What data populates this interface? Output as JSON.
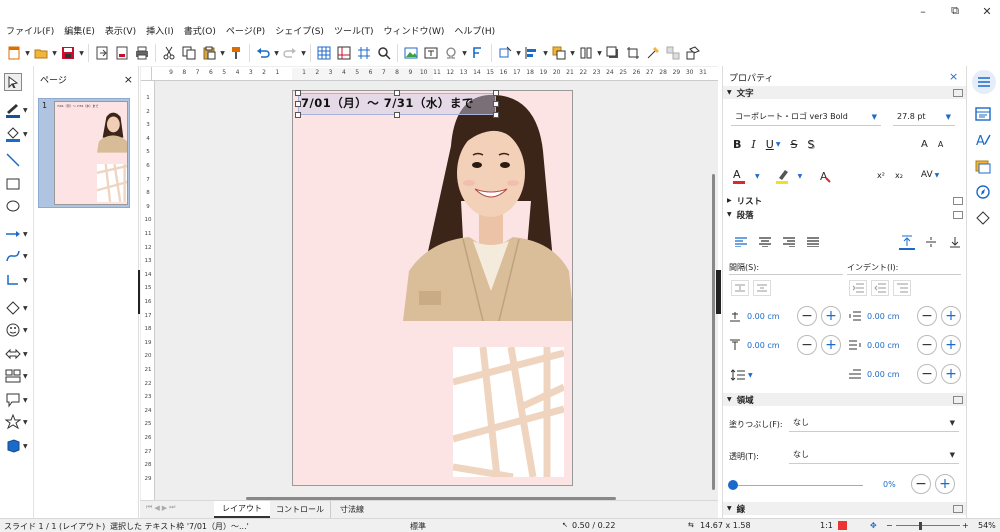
{
  "menubar": {
    "items": [
      "ファイル(F)",
      "編集(E)",
      "表示(V)",
      "挿入(I)",
      "書式(O)",
      "ページ(P)",
      "シェイプ(S)",
      "ツール(T)",
      "ウィンドウ(W)",
      "ヘルプ(H)"
    ]
  },
  "window": {
    "minimize": "–",
    "restore": "⧉",
    "close": "✕"
  },
  "pages_panel": {
    "title": "ページ",
    "close": "×",
    "page_number": "1",
    "thumb_text": "7/01（月）～ 7/31（水）まで"
  },
  "document": {
    "textbox_text": "7/01（月）～ 7/31（水）まで"
  },
  "ruler": {
    "h_ticks": [
      "9",
      "8",
      "7",
      "6",
      "5",
      "4",
      "3",
      "2",
      "1",
      "",
      "1",
      "2",
      "3",
      "4",
      "5",
      "6",
      "7",
      "8",
      "9",
      "10",
      "11",
      "12",
      "13",
      "14",
      "15",
      "16",
      "17",
      "18",
      "19",
      "20",
      "21",
      "22",
      "23",
      "24",
      "25",
      "26",
      "27",
      "28",
      "29",
      "30",
      "31"
    ],
    "v_ticks": [
      "1",
      "2",
      "3",
      "4",
      "5",
      "6",
      "7",
      "8",
      "9",
      "10",
      "11",
      "12",
      "13",
      "14",
      "15",
      "16",
      "17",
      "18",
      "19",
      "20",
      "21",
      "22",
      "23",
      "24",
      "25",
      "26",
      "27",
      "28",
      "29"
    ]
  },
  "tabs": [
    "レイアウト",
    "コントロール",
    "寸法線"
  ],
  "properties": {
    "title": "プロパティ",
    "close": "×",
    "char_section": "文字",
    "font_name": "コーポレート・ロゴ ver3 Bold",
    "font_size": "27.8 pt",
    "bold": "B",
    "italic": "I",
    "underline": "U",
    "strike": "S",
    "shadow": "S",
    "grow": "A",
    "shrink": "A",
    "superscript": "x²",
    "subscript": "x₂",
    "spacing": "AV",
    "list_section": "リスト",
    "para_section": "段落",
    "spacing_label": "間隔(S):",
    "indent_label": "インデント(I):",
    "above_value": "0.00 cm",
    "below_value": "0.00 cm",
    "before_indent": "0.00 cm",
    "after_indent": "0.00 cm",
    "first_indent": "0.00 cm",
    "area_section": "領域",
    "fill_label": "塗りつぶし(F):",
    "fill_value": "なし",
    "transparency_label": "透明(T):",
    "transparency_value": "なし",
    "transparency_percent": "0%",
    "line_section": "線",
    "minus": "−",
    "plus": "+"
  },
  "status": {
    "slide": "スライド 1 / 1 (レイアウト)",
    "selection": "選択した テキスト枠 '7/01（月）～...'",
    "style": "標準",
    "position": "0.50 / 0.22",
    "size": "14.67 x 1.58",
    "scale": "1:1",
    "zoom": "54%"
  },
  "colors": {
    "accent": "#1b6ac9",
    "page_bg": "#fde4e4",
    "pattern": "#efd5c0",
    "font_color": "#d92b2b",
    "highlight": "#f2e11e"
  }
}
